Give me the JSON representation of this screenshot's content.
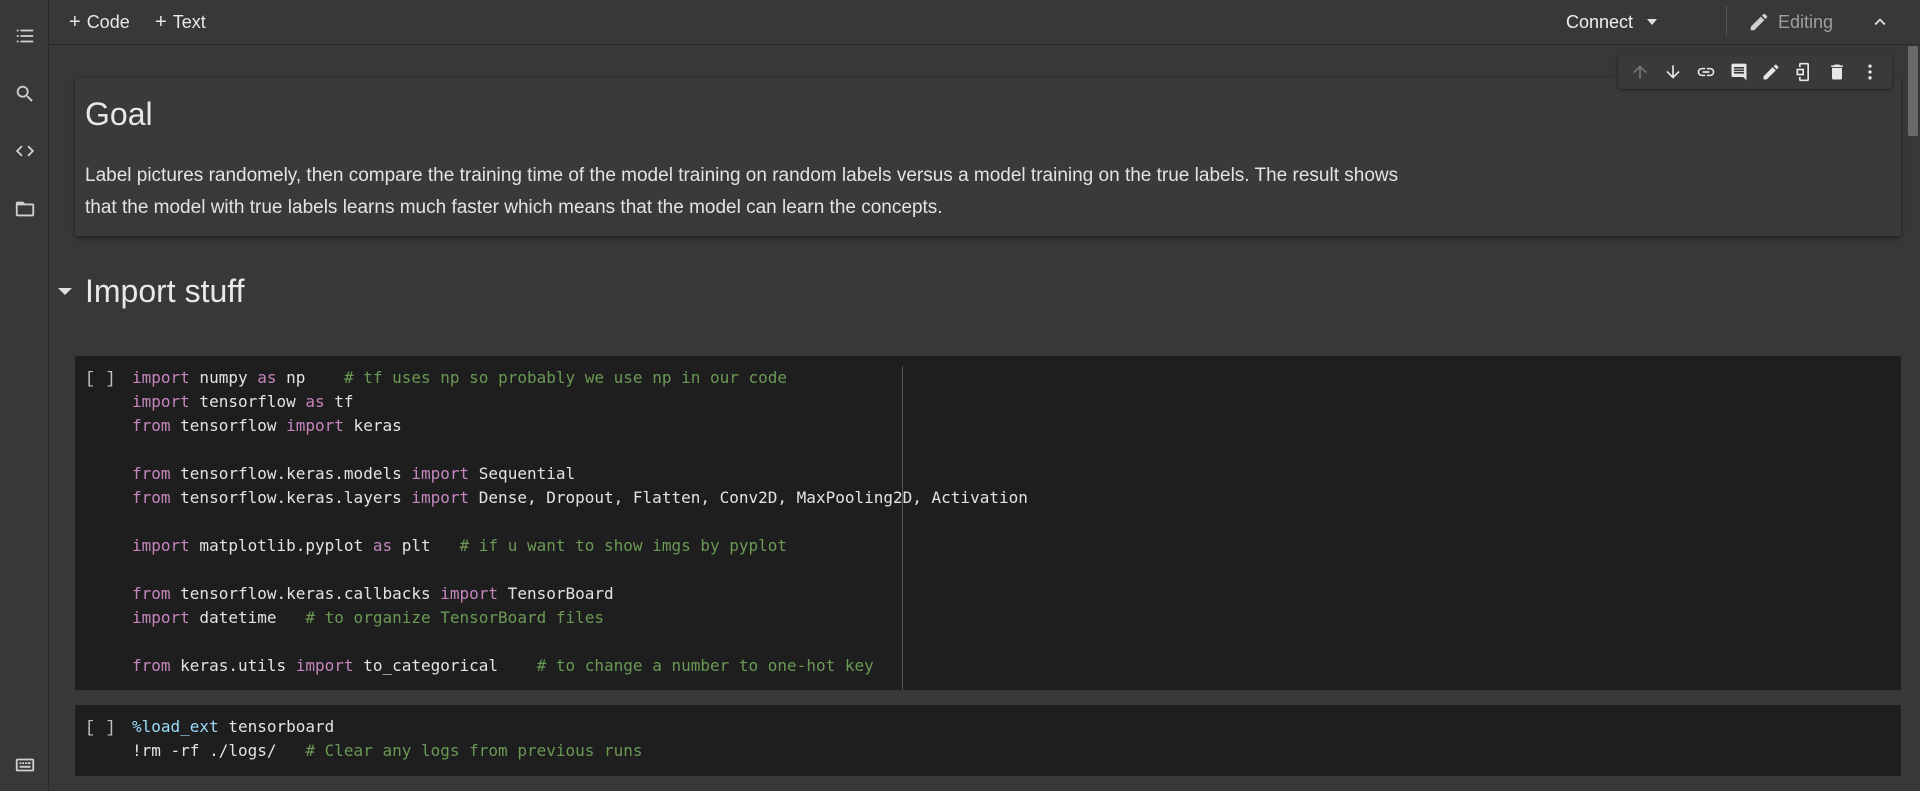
{
  "toolbar": {
    "add_code_label": "Code",
    "add_text_label": "Text",
    "connect_label": "Connect",
    "editing_label": "Editing"
  },
  "sidebar": {
    "icons": [
      "table-of-contents-icon",
      "search-icon",
      "code-snippets-icon",
      "files-icon",
      "terminal-icon"
    ]
  },
  "cell_toolbar": {
    "icons": [
      "move-up-icon",
      "move-down-icon",
      "link-icon",
      "comment-icon",
      "edit-icon",
      "mirror-cell-icon",
      "delete-icon",
      "more-icon"
    ]
  },
  "text_cell": {
    "heading": "Goal",
    "paragraph": "Label pictures randomely, then compare the training time of the model training on random labels versus a model training on the true labels. The result shows that the model with true labels learns much faster which means that the model can learn the concepts."
  },
  "section": {
    "heading": "Import stuff"
  },
  "code_cells": [
    {
      "run_label": "[ ]",
      "lines": [
        [
          [
            "k",
            "import"
          ],
          [
            "t",
            " numpy "
          ],
          [
            "k",
            "as"
          ],
          [
            "t",
            " np    "
          ],
          [
            "c",
            "# tf uses np so probably we use np in our code"
          ]
        ],
        [
          [
            "k",
            "import"
          ],
          [
            "t",
            " tensorflow "
          ],
          [
            "k",
            "as"
          ],
          [
            "t",
            " tf"
          ]
        ],
        [
          [
            "k",
            "from"
          ],
          [
            "t",
            " tensorflow "
          ],
          [
            "k",
            "import"
          ],
          [
            "t",
            " keras"
          ]
        ],
        [],
        [
          [
            "k",
            "from"
          ],
          [
            "t",
            " tensorflow.keras.models "
          ],
          [
            "k",
            "import"
          ],
          [
            "t",
            " Sequential"
          ]
        ],
        [
          [
            "k",
            "from"
          ],
          [
            "t",
            " tensorflow.keras.layers "
          ],
          [
            "k",
            "import"
          ],
          [
            "t",
            " Dense, Dropout, Flatten, Conv2D, MaxPooling2D, Activation"
          ]
        ],
        [],
        [
          [
            "k",
            "import"
          ],
          [
            "t",
            " matplotlib.pyplot "
          ],
          [
            "k",
            "as"
          ],
          [
            "t",
            " plt   "
          ],
          [
            "c",
            "# if u want to show imgs by pyplot"
          ]
        ],
        [],
        [
          [
            "k",
            "from"
          ],
          [
            "t",
            " tensorflow.keras.callbacks "
          ],
          [
            "k",
            "import"
          ],
          [
            "t",
            " TensorBoard"
          ]
        ],
        [
          [
            "k",
            "import"
          ],
          [
            "t",
            " datetime   "
          ],
          [
            "c",
            "# to organize TensorBoard files"
          ]
        ],
        [],
        [
          [
            "k",
            "from"
          ],
          [
            "t",
            " keras.utils "
          ],
          [
            "k",
            "import"
          ],
          [
            "t",
            " to_categorical    "
          ],
          [
            "c",
            "# to change a number to one-hot key"
          ]
        ]
      ]
    },
    {
      "run_label": "[ ]",
      "lines": [
        [
          [
            "m",
            "%load_ext"
          ],
          [
            "t",
            " tensorboard"
          ]
        ],
        [
          [
            "t",
            "!rm -rf ./logs/   "
          ],
          [
            "c",
            "# Clear any logs from previous runs"
          ]
        ]
      ]
    }
  ]
}
